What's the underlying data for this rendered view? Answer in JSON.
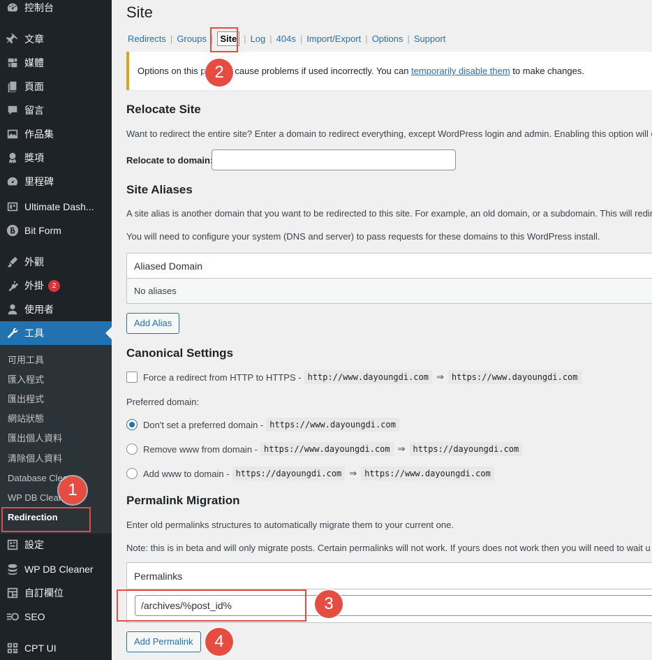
{
  "sidebar": {
    "items": [
      {
        "label": "控制台",
        "icon": "dashboard-icon"
      },
      {
        "label": "文章",
        "icon": "pin-icon"
      },
      {
        "label": "媒體",
        "icon": "media-icon"
      },
      {
        "label": "頁面",
        "icon": "page-icon"
      },
      {
        "label": "留言",
        "icon": "comment-icon"
      },
      {
        "label": "作品集",
        "icon": "portfolio-icon"
      },
      {
        "label": "獎項",
        "icon": "award-icon"
      },
      {
        "label": "里程碑",
        "icon": "milestone-icon"
      },
      {
        "label": "Ultimate Dash...",
        "icon": "ultimate-dashboard-icon"
      },
      {
        "label": "Bit Form",
        "icon": "bit-form-icon"
      },
      {
        "label": "外觀",
        "icon": "appearance-icon"
      },
      {
        "label": "外掛",
        "icon": "plugin-icon",
        "badge": "2"
      },
      {
        "label": "使用者",
        "icon": "user-icon"
      },
      {
        "label": "工具",
        "icon": "tools-icon"
      },
      {
        "label": "設定",
        "icon": "settings-icon"
      },
      {
        "label": "WP DB Cleaner",
        "icon": "database-icon"
      },
      {
        "label": "自訂欄位",
        "icon": "custom-fields-icon"
      },
      {
        "label": "SEO",
        "icon": "seo-icon"
      },
      {
        "label": "CPT UI",
        "icon": "cpt-ui-icon"
      }
    ],
    "submenu": [
      "可用工具",
      "匯入程式",
      "匯出程式",
      "網站狀態",
      "匯出個人資料",
      "清除個人資料",
      "Database Clea",
      "WP DB Clean",
      "Redirection"
    ]
  },
  "page": {
    "title": "Site",
    "tabs": [
      "Redirects",
      "Groups",
      "Site",
      "Log",
      "404s",
      "Import/Export",
      "Options",
      "Support"
    ],
    "notice": {
      "before": "Options on this p",
      "after": "n cause problems if used incorrectly. You can ",
      "link": "temporarily disable them",
      "end": " to make changes."
    }
  },
  "relocate": {
    "heading": "Relocate Site",
    "desc": "Want to redirect the entire site? Enter a domain to redirect everything, except WordPress login and admin. Enabling this option will d",
    "label": "Relocate to domain:",
    "value": ""
  },
  "aliases": {
    "heading": "Site Aliases",
    "desc1": "A site alias is another domain that you want to be redirected to this site. For example, an old domain, or a subdomain. This will redir",
    "desc2": "You will need to configure your system (DNS and server) to pass requests for these domains to this WordPress install.",
    "column": "Aliased Domain",
    "empty": "No aliases",
    "button": "Add Alias"
  },
  "canonical": {
    "heading": "Canonical Settings",
    "https_label": "Force a redirect from HTTP to HTTPS -",
    "https_from": "http://www.dayoungdi.com",
    "https_to": "https://www.dayoungdi.com",
    "preferred_label": "Preferred domain:",
    "options": [
      {
        "label": "Don't set a preferred domain -",
        "codes": [
          "https://www.dayoungdi.com"
        ],
        "selected": true
      },
      {
        "label": "Remove www from domain -",
        "codes": [
          "https://www.dayoungdi.com",
          "https://dayoungdi.com"
        ],
        "selected": false
      },
      {
        "label": "Add www to domain -",
        "codes": [
          "https://dayoungdi.com",
          "https://www.dayoungdi.com"
        ],
        "selected": false
      }
    ],
    "arrow": "⇒"
  },
  "permalink": {
    "heading": "Permalink Migration",
    "desc1": "Enter old permalinks structures to automatically migrate them to your current one.",
    "desc2": "Note: this is in beta and will only migrate posts. Certain permalinks will not work. If yours does not work then you will need to wait u",
    "column": "Permalinks",
    "value": "/archives/%post_id%",
    "button": "Add Permalink"
  },
  "annotations": [
    "1",
    "2",
    "3",
    "4"
  ],
  "colors": {
    "sidebar": "#1d2327",
    "active": "#2271b1",
    "annotation": "#e54d42",
    "link": "#2271b1"
  }
}
